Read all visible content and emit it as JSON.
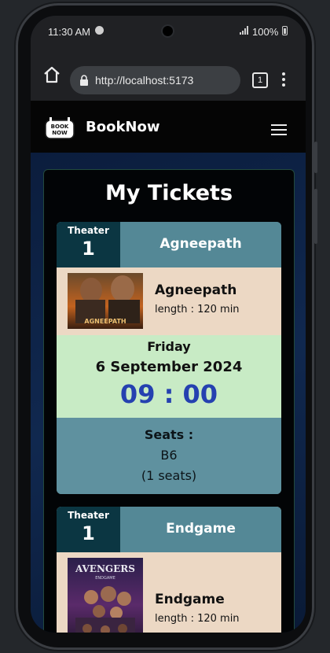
{
  "status_bar": {
    "time": "11:30 AM",
    "battery": "100%"
  },
  "browser": {
    "url": "http://localhost:5173",
    "tab_count": "1"
  },
  "app": {
    "brand": "BookNow",
    "logo_text_top": "BOOK",
    "logo_text_bottom": "NOW"
  },
  "page": {
    "title": "My Tickets"
  },
  "tickets": [
    {
      "theater_label": "Theater",
      "theater_number": "1",
      "title": "Agneepath",
      "movie_name": "Agneepath",
      "length": "length : 120 min",
      "poster_caption": "AGNEEPATH",
      "day": "Friday",
      "date": "6 September 2024",
      "time": "09 : 00",
      "seats_label": "Seats :",
      "seats": "B6",
      "seat_count": "(1 seats)"
    },
    {
      "theater_label": "Theater",
      "theater_number": "1",
      "title": "Endgame",
      "movie_name": "Endgame",
      "length": "length : 120 min",
      "poster_caption": "AVENGERS",
      "poster_subcaption": "ENDGAME"
    }
  ],
  "colors": {
    "theater_block": "#0b3642",
    "ticket_header": "#548896",
    "movie_row": "#ecd8c4",
    "time_row": "#c8ebc5",
    "time_text": "#2541b0",
    "seats_row": "#5f919f"
  },
  "icons": [
    "spotify-icon",
    "signal-icon",
    "battery-icon",
    "home-icon",
    "lock-icon",
    "tabs-icon",
    "more-vert-icon",
    "hamburger-menu-icon"
  ]
}
